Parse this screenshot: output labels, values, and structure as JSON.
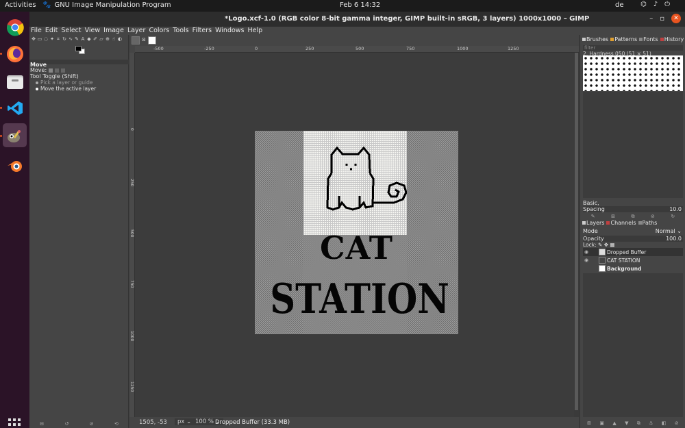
{
  "topbar": {
    "activities": "Activities",
    "app_name": "GNU Image Manipulation Program",
    "clock": "Feb 6  14:32",
    "lang": "de"
  },
  "dock": {
    "items": [
      "chrome-icon",
      "firefox-icon",
      "files-icon",
      "vscode-icon",
      "gimp-icon",
      "blender-icon"
    ],
    "active": "gimp-icon"
  },
  "window": {
    "title": "*Logo.xcf-1.0 (RGB color 8-bit gamma integer, GIMP built-in sRGB, 3 layers) 1000x1000 – GIMP"
  },
  "menubar": [
    "File",
    "Edit",
    "Select",
    "View",
    "Image",
    "Layer",
    "Colors",
    "Tools",
    "Filters",
    "Windows",
    "Help"
  ],
  "tool_options": {
    "title": "Move",
    "move_label": "Move:",
    "toggle_label": "Tool Toggle  (Shift)",
    "option_1": "Pick a layer or guide",
    "option_2": "Move the active layer"
  },
  "ruler": {
    "h_ticks": [
      "-500",
      "-250",
      "0",
      "250",
      "500",
      "750",
      "1000",
      "1250"
    ],
    "v_ticks": [
      "0",
      "250",
      "500",
      "750",
      "1000",
      "1250"
    ]
  },
  "image_text": {
    "line1": "CAT",
    "line2": "STATION"
  },
  "status": {
    "coords": "1505, -53",
    "unit": "px",
    "zoom": "100 %",
    "message": "Dropped Buffer (33.3 MB)"
  },
  "brushes_dock": {
    "tabs": [
      "Brushes",
      "Patterns",
      "Fonts",
      "History"
    ],
    "filter_placeholder": "filter",
    "brush_name": "2. Hardness 050 (51 × 51)",
    "preset": "Basic,",
    "spacing_label": "Spacing",
    "spacing_value": "10.0"
  },
  "layers_dock": {
    "tabs": [
      "Layers",
      "Channels",
      "Paths"
    ],
    "mode_label": "Mode",
    "mode_value": "Normal",
    "opacity_label": "Opacity",
    "opacity_value": "100.0",
    "lock_label": "Lock:",
    "layers": [
      {
        "name": "Dropped Buffer",
        "visible": true,
        "selected": true
      },
      {
        "name": "CAT STATION",
        "visible": true,
        "selected": false
      },
      {
        "name": "Background",
        "visible": false,
        "selected": false
      }
    ]
  },
  "colors": {
    "accent": "#e95420",
    "dock_bg": "#2b1327",
    "panel_bg": "#454545"
  }
}
